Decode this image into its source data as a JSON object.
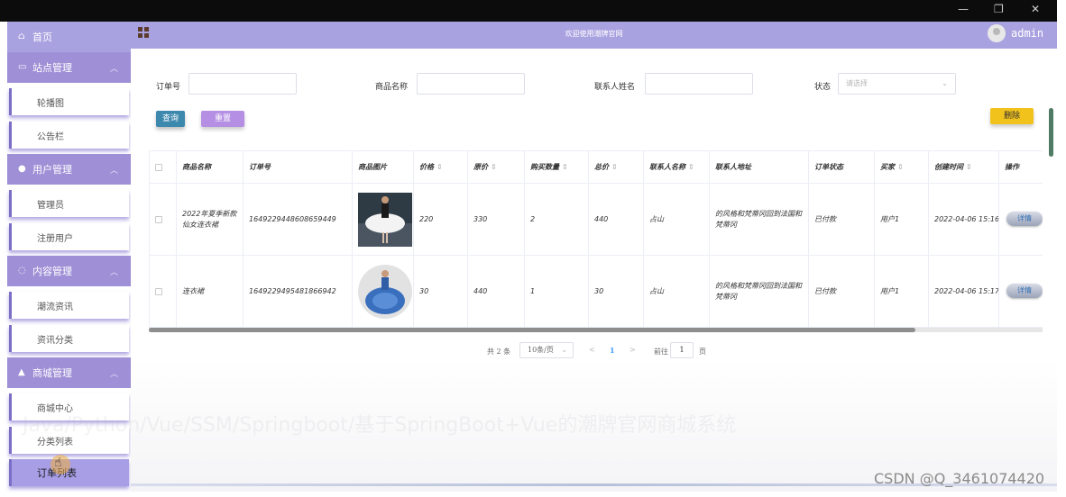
{
  "window": {
    "minimize": "—",
    "restore": "❐",
    "close": "✕"
  },
  "sidebar": {
    "home": "首页",
    "groups": [
      {
        "title": "站点管理",
        "icon": "monitor-icon",
        "items": [
          "轮播图",
          "公告栏"
        ]
      },
      {
        "title": "用户管理",
        "icon": "user-icon",
        "items": [
          "管理员",
          "注册用户"
        ]
      },
      {
        "title": "内容管理",
        "icon": "chat-icon",
        "items": [
          "潮流资讯",
          "资讯分类"
        ]
      },
      {
        "title": "商城管理",
        "icon": "shop-icon",
        "items": [
          "商城中心",
          "分类列表",
          "订单列表"
        ]
      }
    ],
    "active_item": "订单列表"
  },
  "header": {
    "title": "欢迎使用潮牌官网",
    "user": "admin"
  },
  "filters": {
    "order_no_label": "订单号",
    "product_label": "商品名称",
    "contact_label": "联系人姓名",
    "status_label": "状态",
    "status_placeholder": "请选择"
  },
  "buttons": {
    "search": "查询",
    "reset": "重置",
    "delete": "删除",
    "detail": "详情"
  },
  "table": {
    "columns": [
      "商品名称",
      "订单号",
      "商品图片",
      "价格",
      "原价",
      "购买数量",
      "总价",
      "联系人名称",
      "联系人地址",
      "订单状态",
      "买家",
      "创建时间",
      "操作"
    ],
    "rows": [
      {
        "name": "2022年夏季新款仙女连衣裙",
        "order_no": "1649229448608659449",
        "price": "220",
        "original_price": "330",
        "qty": "2",
        "total": "440",
        "contact": "占山",
        "address": "的风格和梵蒂冈回到法国和梵蒂冈",
        "status": "已付款",
        "buyer": "用户1",
        "created": "2022-04-06 15:16:",
        "image": "white-dress-image"
      },
      {
        "name": "连衣裙",
        "order_no": "1649229495481866942",
        "price": "30",
        "original_price": "440",
        "qty": "1",
        "total": "30",
        "contact": "占山",
        "address": "的风格和梵蒂冈回到法国和梵蒂冈",
        "status": "已付款",
        "buyer": "用户1",
        "created": "2022-04-06 15:17:",
        "image": "blue-gown-image"
      }
    ]
  },
  "pagination": {
    "total": "共 2 条",
    "page_size": "10条/页",
    "prev": "<",
    "current": "1",
    "next": ">",
    "goto": "前往",
    "goto_value": "1",
    "page_suffix": "页"
  },
  "watermark_faint": "Java/Python/Vue/SSM/Springboot/基于SpringBoot+Vue的潮牌官网商城系统",
  "watermark": "CSDN @Q_3461074420",
  "colors": {
    "sidebar_head": "#9e8fd6",
    "header": "#a9a2e0",
    "search_btn": "#3d88ad",
    "reset_btn": "#b48fe3",
    "delete_btn": "#f2c21c"
  }
}
